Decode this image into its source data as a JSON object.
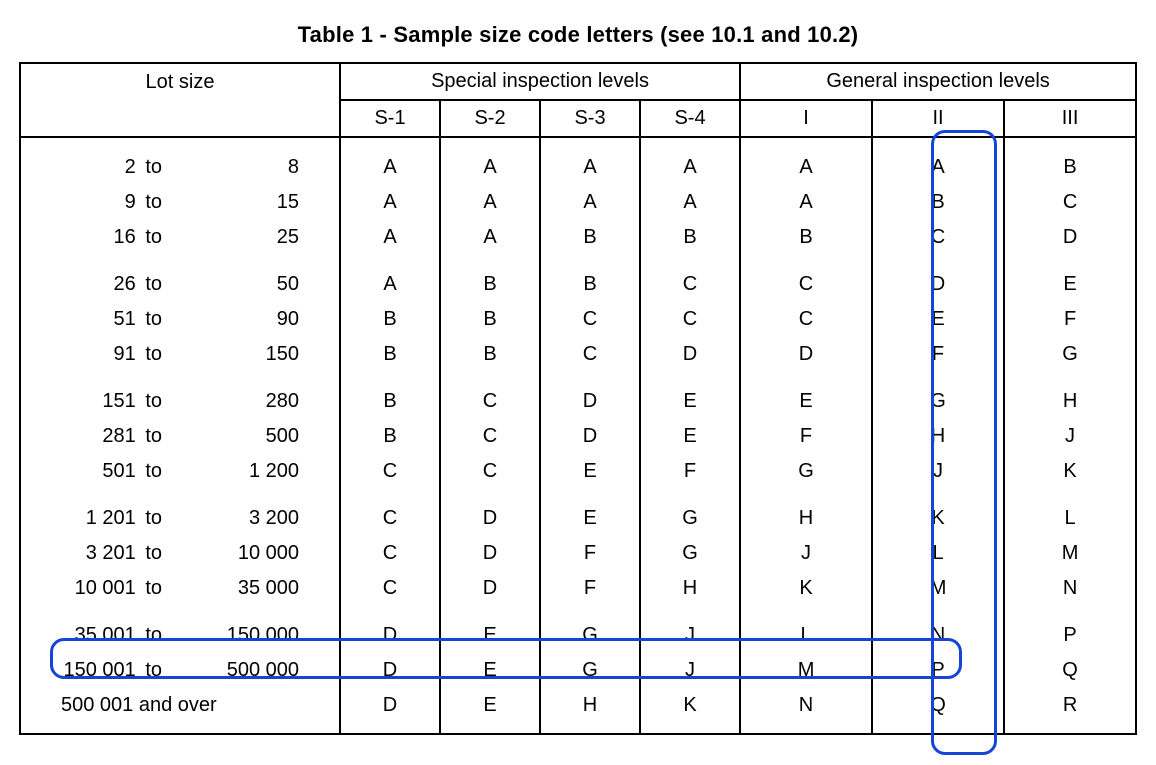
{
  "title": "Table 1 - Sample size code letters (see 10.1 and 10.2)",
  "headers": {
    "lot": "Lot size",
    "special": "Special inspection levels",
    "general": "General inspection levels",
    "sub": {
      "s1": "S-1",
      "s2": "S-2",
      "s3": "S-3",
      "s4": "S-4",
      "g1": "I",
      "g2": "II",
      "g3": "III"
    }
  },
  "to_word": "to",
  "and_over": "and over",
  "rows": [
    {
      "from": "2",
      "to": "8",
      "s1": "A",
      "s2": "A",
      "s3": "A",
      "s4": "A",
      "g1": "A",
      "g2": "A",
      "g3": "B"
    },
    {
      "from": "9",
      "to": "15",
      "s1": "A",
      "s2": "A",
      "s3": "A",
      "s4": "A",
      "g1": "A",
      "g2": "B",
      "g3": "C"
    },
    {
      "from": "16",
      "to": "25",
      "s1": "A",
      "s2": "A",
      "s3": "B",
      "s4": "B",
      "g1": "B",
      "g2": "C",
      "g3": "D"
    },
    {
      "from": "26",
      "to": "50",
      "s1": "A",
      "s2": "B",
      "s3": "B",
      "s4": "C",
      "g1": "C",
      "g2": "D",
      "g3": "E"
    },
    {
      "from": "51",
      "to": "90",
      "s1": "B",
      "s2": "B",
      "s3": "C",
      "s4": "C",
      "g1": "C",
      "g2": "E",
      "g3": "F"
    },
    {
      "from": "91",
      "to": "150",
      "s1": "B",
      "s2": "B",
      "s3": "C",
      "s4": "D",
      "g1": "D",
      "g2": "F",
      "g3": "G"
    },
    {
      "from": "151",
      "to": "280",
      "s1": "B",
      "s2": "C",
      "s3": "D",
      "s4": "E",
      "g1": "E",
      "g2": "G",
      "g3": "H"
    },
    {
      "from": "281",
      "to": "500",
      "s1": "B",
      "s2": "C",
      "s3": "D",
      "s4": "E",
      "g1": "F",
      "g2": "H",
      "g3": "J"
    },
    {
      "from": "501",
      "to": "1 200",
      "s1": "C",
      "s2": "C",
      "s3": "E",
      "s4": "F",
      "g1": "G",
      "g2": "J",
      "g3": "K"
    },
    {
      "from": "1 201",
      "to": "3 200",
      "s1": "C",
      "s2": "D",
      "s3": "E",
      "s4": "G",
      "g1": "H",
      "g2": "K",
      "g3": "L"
    },
    {
      "from": "3 201",
      "to": "10 000",
      "s1": "C",
      "s2": "D",
      "s3": "F",
      "s4": "G",
      "g1": "J",
      "g2": "L",
      "g3": "M"
    },
    {
      "from": "10 001",
      "to": "35 000",
      "s1": "C",
      "s2": "D",
      "s3": "F",
      "s4": "H",
      "g1": "K",
      "g2": "M",
      "g3": "N"
    },
    {
      "from": "35 001",
      "to": "150 000",
      "s1": "D",
      "s2": "E",
      "s3": "G",
      "s4": "J",
      "g1": "L",
      "g2": "N",
      "g3": "P"
    },
    {
      "from": "150 001",
      "to": "500 000",
      "s1": "D",
      "s2": "E",
      "s3": "G",
      "s4": "J",
      "g1": "M",
      "g2": "P",
      "g3": "Q"
    },
    {
      "from": "500 001",
      "to": "",
      "over": true,
      "s1": "D",
      "s2": "E",
      "s3": "H",
      "s4": "K",
      "g1": "N",
      "g2": "Q",
      "g3": "R"
    }
  ],
  "highlights": {
    "row_index": 12,
    "col_key": "g2"
  }
}
